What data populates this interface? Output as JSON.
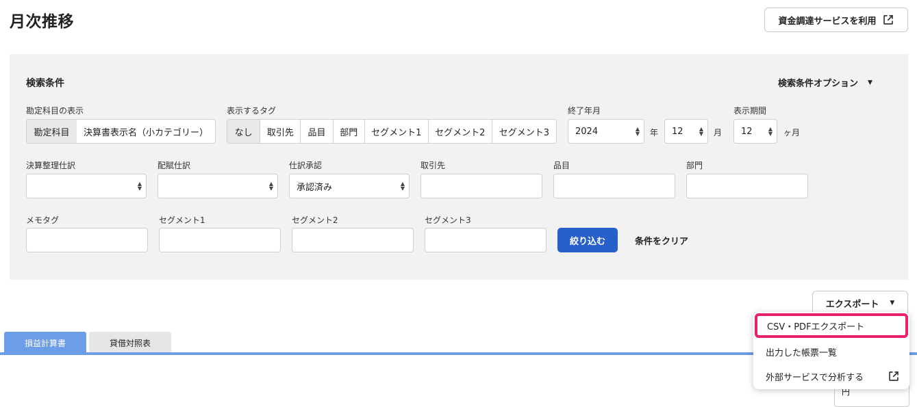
{
  "page": {
    "title": "月次推移"
  },
  "header": {
    "funding_button": "資金調達サービスを利用"
  },
  "search": {
    "title": "検索条件",
    "options_label": "検索条件オプション",
    "account_display": {
      "label": "勘定科目の表示",
      "tag": "勘定科目",
      "value": "決算書表示名（小カテゴリー）"
    },
    "display_tag": {
      "label": "表示するタグ",
      "options": [
        "なし",
        "取引先",
        "品目",
        "部門",
        "セグメント1",
        "セグメント2",
        "セグメント3"
      ],
      "selected": "なし"
    },
    "end_month": {
      "label": "終了年月",
      "year": "2024",
      "year_unit": "年",
      "month": "12",
      "month_unit": "月"
    },
    "period": {
      "label": "表示期間",
      "value": "12",
      "unit": "ヶ月"
    },
    "closing_entries": {
      "label": "決算整理仕訳",
      "value": ""
    },
    "allocation_entries": {
      "label": "配賦仕訳",
      "value": ""
    },
    "approval": {
      "label": "仕訳承認",
      "value": "承認済み"
    },
    "partner": {
      "label": "取引先",
      "value": ""
    },
    "item": {
      "label": "品目",
      "value": ""
    },
    "department": {
      "label": "部門",
      "value": ""
    },
    "memo_tag": {
      "label": "メモタグ",
      "value": ""
    },
    "segment1": {
      "label": "セグメント1",
      "value": ""
    },
    "segment2": {
      "label": "セグメント2",
      "value": ""
    },
    "segment3": {
      "label": "セグメント3",
      "value": ""
    },
    "filter_button": "絞り込む",
    "clear_button": "条件をクリア"
  },
  "export": {
    "button": "エクスポート",
    "menu": [
      "CSV・PDFエクスポート",
      "出力した帳票一覧",
      "外部サービスで分析する"
    ]
  },
  "tabs": [
    "損益計算書",
    "貸借対照表"
  ],
  "partial_select": "円",
  "colors": {
    "primary": "#2860c9",
    "tab_active": "#6d9ce8",
    "highlight": "#e8216b"
  }
}
